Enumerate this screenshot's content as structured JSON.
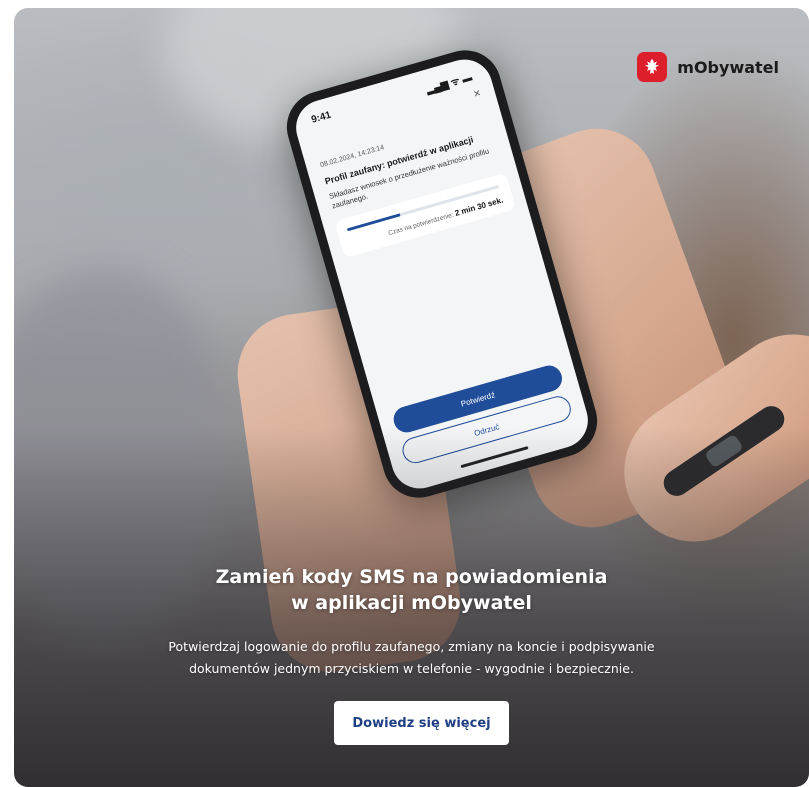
{
  "brand": {
    "name": "mObywatel",
    "badge_color": "#dc1f2b"
  },
  "phone": {
    "status_time": "9:41",
    "status_icons": "▂▄▆ ᯤ ▬",
    "close": "×",
    "date": "08.02.2024, 14:23:14",
    "title": "Profil zaufany: potwierdź w aplikacji",
    "description": "Składasz wniosek o przedłużenie ważności profilu zaufanego.",
    "progress": 0.35,
    "time_label": "Czas na potwierdzenie:",
    "time_value": "2 min 30 sek.",
    "confirm_label": "Potwierdź",
    "reject_label": "Odrzuć"
  },
  "hero": {
    "headline_line1": "Zamień kody SMS na powiadomienia",
    "headline_line2": "w aplikacji mObywatel",
    "sub_line1": "Potwierdzaj logowanie do profilu zaufanego, zmiany na koncie i podpisywanie",
    "sub_line2": "dokumentów jednym przyciskiem w telefonie - wygodnie i bezpiecznie.",
    "cta_label": "Dowiedz się więcej"
  },
  "colors": {
    "primary": "#1f4d99",
    "cta_text": "#1f3f84"
  }
}
